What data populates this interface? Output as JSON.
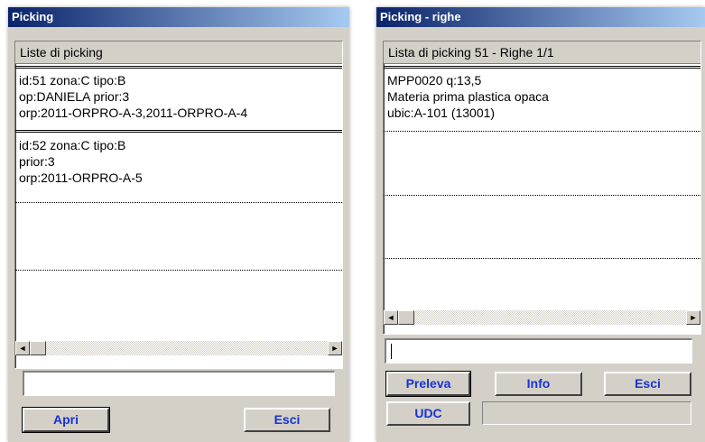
{
  "left_window": {
    "title": "Picking",
    "list_header": "Liste di picking",
    "items": [
      {
        "lines": [
          "id:51   zona:C   tipo:B",
          "op:DANIELA   prior:3",
          "orp:2011-ORPRO-A-3,2011-ORPRO-A-4"
        ]
      },
      {
        "lines": [
          "id:52   zona:C   tipo:B",
          "prior:3",
          "orp:2011-ORPRO-A-5"
        ]
      }
    ],
    "input_value": "",
    "buttons": {
      "open": "Apri",
      "exit": "Esci"
    }
  },
  "right_window": {
    "title": "Picking - righe",
    "list_header": "Lista di picking 51 - Righe 1/1",
    "items": [
      {
        "lines": [
          "MPP0020   q:13,5",
          "Materia prima plastica opaca",
          "ubic:A-101 (13001)"
        ]
      }
    ],
    "input_value": "",
    "buttons": {
      "pick": "Preleva",
      "info": "Info",
      "exit": "Esci",
      "udc": "UDC"
    }
  },
  "icons": {
    "scroll_left": "◄",
    "scroll_right": "►"
  },
  "colors": {
    "titlebar": "#0a246a",
    "button_text": "#1633d4",
    "window_bg": "#d4d0c8"
  }
}
